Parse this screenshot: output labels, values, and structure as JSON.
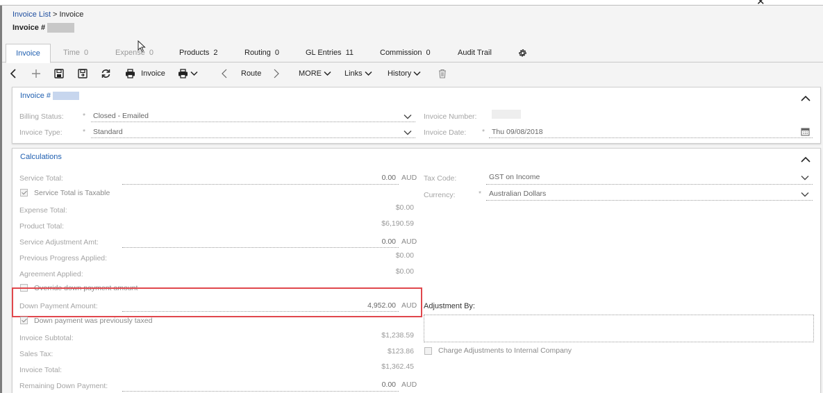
{
  "breadcrumb": {
    "parent": "Invoice List",
    "separator": ">",
    "current": "Invoice"
  },
  "title": "Invoice #",
  "tabs": [
    {
      "label": "Invoice",
      "count": ""
    },
    {
      "label": "Time",
      "count": "0"
    },
    {
      "label": "Expense",
      "count": "0"
    },
    {
      "label": "Products",
      "count": "2"
    },
    {
      "label": "Routing",
      "count": "0"
    },
    {
      "label": "GL Entries",
      "count": "11"
    },
    {
      "label": "Commission",
      "count": "0"
    },
    {
      "label": "Audit Trail",
      "count": ""
    }
  ],
  "toolbar": {
    "print_label": "Invoice",
    "route_label": "Route",
    "more_label": "MORE",
    "links_label": "Links",
    "history_label": "History"
  },
  "invoice_panel": {
    "title": "Invoice #",
    "billing_status_label": "Billing Status:",
    "billing_status_value": "Closed - Emailed",
    "invoice_type_label": "Invoice Type:",
    "invoice_type_value": "Standard",
    "invoice_number_label": "Invoice Number:",
    "invoice_date_label": "Invoice Date:",
    "invoice_date_value": "Thu 09/08/2018",
    "required_mark": "*"
  },
  "calc_panel": {
    "title": "Calculations",
    "service_total_label": "Service Total:",
    "service_total_value": "0.00",
    "service_taxable_label": "Service Total is Taxable",
    "expense_total_label": "Expense Total:",
    "expense_total_value": "$0.00",
    "product_total_label": "Product Total:",
    "product_total_value": "$6,190.59",
    "service_adj_label": "Service Adjustment Amt:",
    "service_adj_value": "0.00",
    "prev_progress_label": "Previous Progress Applied:",
    "prev_progress_value": "$0.00",
    "agreement_label": "Agreement Applied:",
    "agreement_value": "$0.00",
    "override_label": "Override down payment amount",
    "down_payment_label": "Down Payment Amount:",
    "down_payment_value": "4,952.00",
    "prev_taxed_label": "Down payment was previously taxed",
    "subtotal_label": "Invoice Subtotal:",
    "subtotal_value": "$1,238.59",
    "sales_tax_label": "Sales Tax:",
    "sales_tax_value": "$123.86",
    "invoice_total_label": "Invoice Total:",
    "invoice_total_value": "$1,362.45",
    "remaining_dp_label": "Remaining Down Payment:",
    "remaining_dp_value": "0.00",
    "currency_unit": "AUD",
    "tax_code_label": "Tax Code:",
    "tax_code_value": "GST on Income",
    "currency_label": "Currency:",
    "currency_value": "Australian Dollars",
    "adjustment_by_label": "Adjustment By:",
    "charge_internal_label": "Charge Adjustments to Internal Company",
    "required_mark": "*"
  },
  "colors": {
    "accent": "#1f5fb0",
    "highlight": "#e0474c",
    "link": "#1f4fa0"
  }
}
